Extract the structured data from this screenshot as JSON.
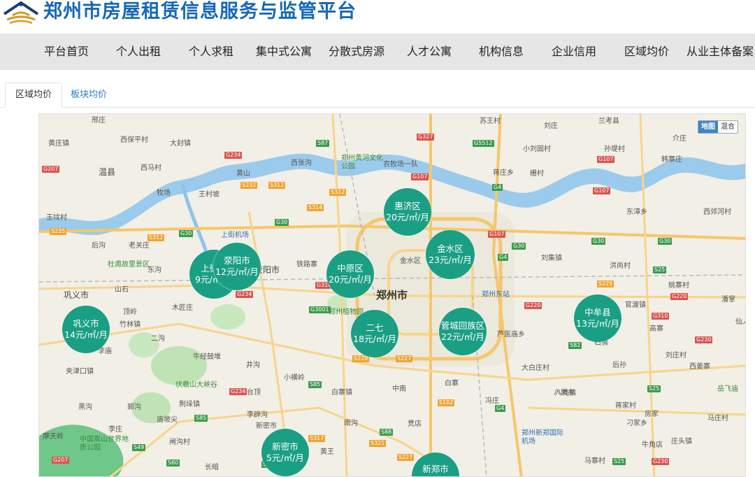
{
  "site": {
    "title": "郑州市房屋租赁信息服务与监管平台"
  },
  "nav": {
    "items": [
      {
        "label": "平台首页"
      },
      {
        "label": "个人出租"
      },
      {
        "label": "个人求租"
      },
      {
        "label": "集中式公寓"
      },
      {
        "label": "分散式房源"
      },
      {
        "label": "人才公寓"
      },
      {
        "label": "机构信息"
      },
      {
        "label": "企业信用"
      },
      {
        "label": "区域均价"
      },
      {
        "label": "从业主体备案"
      }
    ]
  },
  "tabs": {
    "items": [
      {
        "label": "区域均价",
        "active": true
      },
      {
        "label": "板块均价",
        "active": false
      }
    ]
  },
  "map": {
    "toggle": {
      "map": "地图",
      "hybrid": "混合"
    },
    "districts": [
      {
        "name": "惠济区",
        "price": "20元/㎡/月"
      },
      {
        "name": "金水区",
        "price": "23元/㎡/月"
      },
      {
        "name": "上街区",
        "price": "9元/㎡/月"
      },
      {
        "name": "荥阳市",
        "price": "12元/㎡/月"
      },
      {
        "name": "中原区",
        "price": "20元/㎡/月"
      },
      {
        "name": "巩义市",
        "price": "14元/㎡/月"
      },
      {
        "name": "二七",
        "price": "18元/㎡/月"
      },
      {
        "name": "管城回族区",
        "price": "22元/㎡/月"
      },
      {
        "name": "中牟县",
        "price": "13元/㎡/月"
      },
      {
        "name": "新密市",
        "price": "5元/㎡/月"
      },
      {
        "name": "新郑市",
        "price": ""
      }
    ],
    "places": {
      "city": "郑州市",
      "labels": [
        "邢庄",
        "黄庄镇",
        "西保平村",
        "大封镇",
        "温县",
        "西马村",
        "牧场",
        "王村坡",
        "黄山",
        "西张沟",
        "郑州黄河文化公园",
        "农牧场一队",
        "苏王村",
        "小刘固村",
        "蒋庄乡",
        "栅村",
        "刘庄",
        "介庄",
        "孙堤村",
        "韩寨庄",
        "兰考县",
        "东漳乡",
        "西郊河村",
        "王坟村",
        "后沟",
        "老关庄",
        "杜甫故里景区",
        "东沟",
        "巩义市",
        "山石",
        "上街机场",
        "荥阳市",
        "铁路寨",
        "金水区",
        "郑州东站",
        "刘集镇",
        "洪尚村",
        "姚寨村",
        "官渡镇",
        "高寨",
        "潘掌",
        "仙人",
        "木匠庄",
        "顶岭",
        "竹林镇",
        "二沟",
        "李庙",
        "牛经鼓堆",
        "夹津口镇",
        "伏羲山大峡谷",
        "黑沟",
        "郭沟",
        "荆垛镇",
        "庙坡尖",
        "李庄",
        "摩天岭",
        "中国嵩山世界地质公园",
        "闸沟村",
        "长暗",
        "新密市",
        "李辟沟",
        "小横岭",
        "台顶",
        "井沟",
        "白寨镇",
        "南沟",
        "贯店",
        "郑州新郑国际机场",
        "八岗镇",
        "蒋家村",
        "房家",
        "刁家乡",
        "牛角店",
        "马寨村",
        "庄头镇",
        "马庄村",
        "岳飞庙",
        "刘庄村",
        "西姜寨",
        "后孙",
        "大白庄村",
        "芦医庙乡",
        "八岗乡",
        "石佛",
        "郑州植物园",
        "黄王",
        "中南",
        "白寨",
        "冯庄"
      ]
    }
  }
}
